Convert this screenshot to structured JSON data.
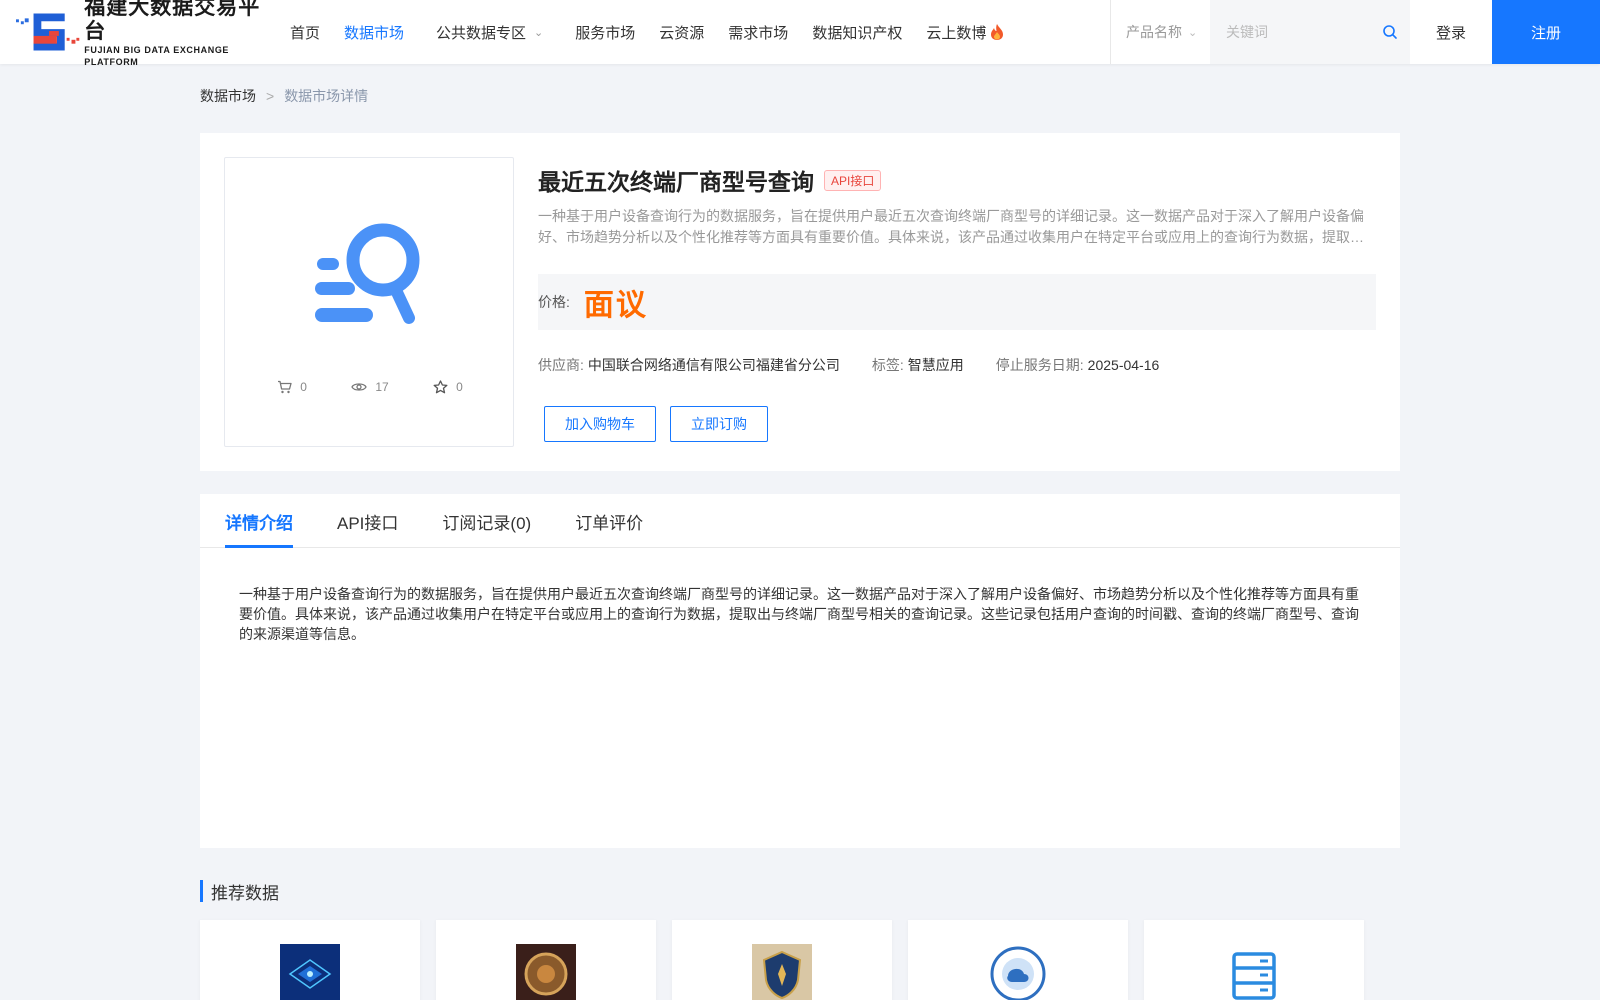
{
  "header": {
    "logo_cn": "福建大数据交易平台",
    "logo_en": "FUJIAN BIG DATA EXCHANGE PLATFORM",
    "nav": [
      {
        "label": "首页"
      },
      {
        "label": "数据市场"
      },
      {
        "label": "公共数据专区"
      },
      {
        "label": "服务市场"
      },
      {
        "label": "云资源"
      },
      {
        "label": "需求市场"
      },
      {
        "label": "数据知识产权"
      },
      {
        "label": "云上数博"
      }
    ],
    "search_type": "产品名称",
    "search_placeholder": "关键词",
    "login": "登录",
    "register": "注册"
  },
  "breadcrumb": {
    "root": "数据市场",
    "separator": ">",
    "current": "数据市场详情"
  },
  "product": {
    "title": "最近五次终端厂商型号查询",
    "badge": "API接口",
    "summary": "一种基于用户设备查询行为的数据服务，旨在提供用户最近五次查询终端厂商型号的详细记录。这一数据产品对于深入了解用户设备偏好、市场趋势分析以及个性化推荐等方面具有重要价值。具体来说，该产品通过收集用户在特定平台或应用上的查询行为数据，提取出与终端厂商型号相关的查询记录。这些记录包括用户查询的时间戳、查询的终端厂商型号、查询的来源渠道等信息。",
    "price_label": "价格:",
    "price_value": "面议",
    "supplier_label": "供应商:",
    "supplier": "中国联合网络通信有限公司福建省分公司",
    "tag_label": "标签:",
    "tag": "智慧应用",
    "end_label": "停止服务日期:",
    "end_date": "2025-04-16",
    "stats": {
      "cart": "0",
      "views": "17",
      "favorites": "0"
    },
    "add_cart": "加入购物车",
    "subscribe": "立即订购"
  },
  "tabs": [
    {
      "label": "详情介绍"
    },
    {
      "label": "API接口"
    },
    {
      "label": "订阅记录(0)"
    },
    {
      "label": "订单评价"
    }
  ],
  "detail_text": "一种基于用户设备查询行为的数据服务，旨在提供用户最近五次查询终端厂商型号的详细记录。这一数据产品对于深入了解用户设备偏好、市场趋势分析以及个性化推荐等方面具有重要价值。具体来说，该产品通过收集用户在特定平台或应用上的查询行为数据，提取出与终端厂商型号相关的查询记录。这些记录包括用户查询的时间戳、查询的终端厂商型号、查询的来源渠道等信息。",
  "recommend": {
    "title": "推荐数据"
  },
  "colors": {
    "accent": "#1677ff",
    "price": "#ff6a00",
    "badge": "#e8453c"
  }
}
